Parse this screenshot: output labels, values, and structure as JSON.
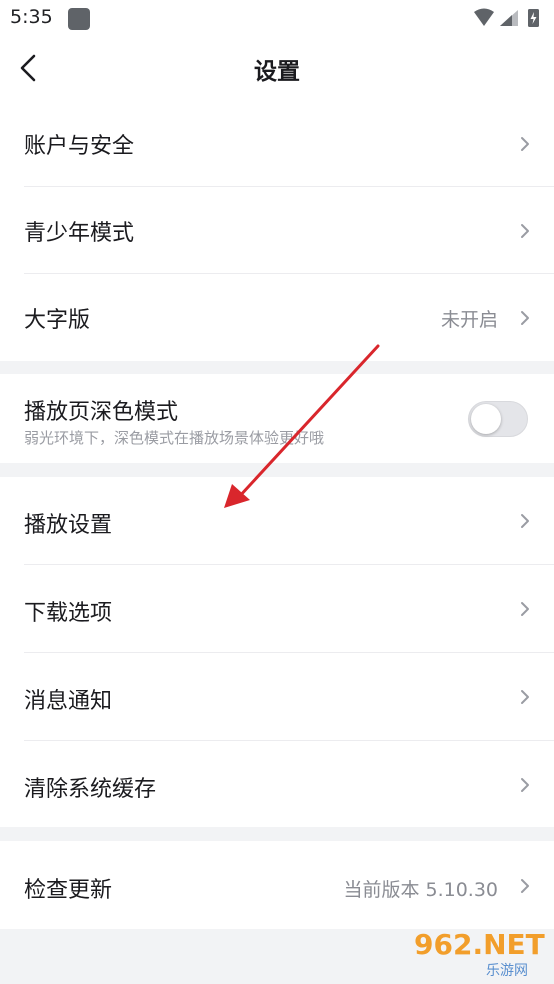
{
  "status_bar": {
    "time": "5:35"
  },
  "header": {
    "title": "设置"
  },
  "rows": {
    "account": {
      "label": "账户与安全"
    },
    "youth": {
      "label": "青少年模式"
    },
    "large_font": {
      "label": "大字版",
      "value": "未开启"
    },
    "dark_mode": {
      "label": "播放页深色模式",
      "subtitle": "弱光环境下，深色模式在播放场景体验更好哦",
      "enabled": false
    },
    "playback": {
      "label": "播放设置"
    },
    "download": {
      "label": "下载选项"
    },
    "notification": {
      "label": "消息通知"
    },
    "clear_cache": {
      "label": "清除系统缓存"
    },
    "check_update": {
      "label": "检查更新",
      "value": "当前版本 5.10.30"
    }
  },
  "watermark": {
    "logo": "962.NET",
    "sub": "乐游网"
  },
  "colors": {
    "annotation_arrow": "#d9262c",
    "toggle_off": "#e4e5e9"
  }
}
